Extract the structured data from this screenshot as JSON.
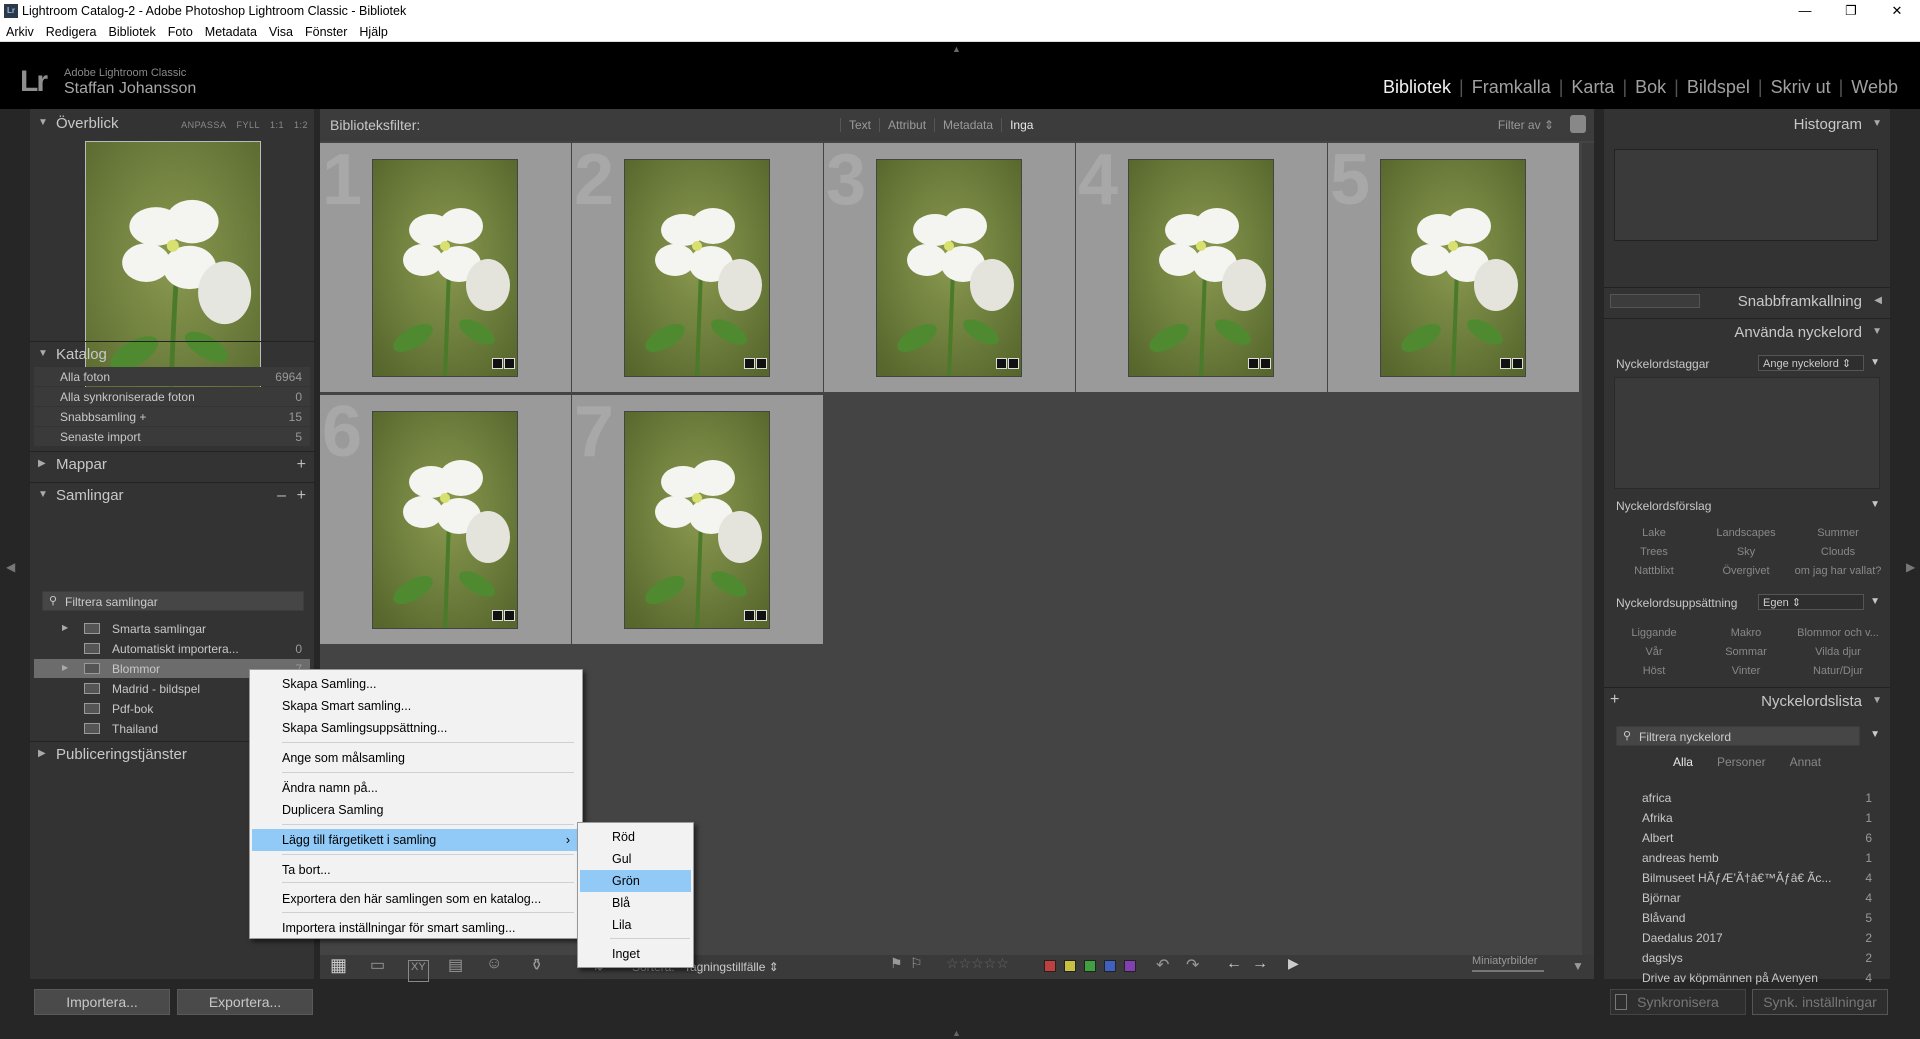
{
  "window": {
    "title": "Lightroom Catalog-2 - Adobe Photoshop Lightroom Classic - Bibliotek",
    "app_icon": "Lr"
  },
  "menubar": [
    "Arkiv",
    "Redigera",
    "Bibliotek",
    "Foto",
    "Metadata",
    "Visa",
    "Fönster",
    "Hjälp"
  ],
  "identity": {
    "logo": "Lr",
    "app_name": "Adobe Lightroom Classic",
    "user": "Staffan Johansson"
  },
  "modules": {
    "active": "Bibliotek",
    "items": [
      "Bibliotek",
      "Framkalla",
      "Karta",
      "Bok",
      "Bildspel",
      "Skriv ut",
      "Webb"
    ]
  },
  "left": {
    "navigator": {
      "title": "Överblick",
      "options": [
        "ANPASSA",
        "FYLL",
        "1:1",
        "1:2"
      ]
    },
    "catalog": {
      "title": "Katalog",
      "items": [
        {
          "label": "Alla foton",
          "count": "6964"
        },
        {
          "label": "Alla synkroniserade foton",
          "count": "0"
        },
        {
          "label": "Snabbsamling +",
          "count": "15"
        },
        {
          "label": "Senaste import",
          "count": "5"
        }
      ]
    },
    "folders": {
      "title": "Mappar",
      "action": "+"
    },
    "collections": {
      "title": "Samlingar",
      "actions": [
        "–",
        "+"
      ],
      "filter_placeholder": "Filtrera samlingar",
      "items": [
        {
          "label": "Smarta samlingar",
          "count": ""
        },
        {
          "label": "Automatiskt importera...",
          "count": "0"
        },
        {
          "label": "Blommor",
          "count": "7"
        },
        {
          "label": "Madrid - bildspel",
          "count": ""
        },
        {
          "label": "Pdf-bok",
          "count": ""
        },
        {
          "label": "Thailand",
          "count": ""
        }
      ]
    },
    "publish": {
      "title": "Publiceringstjänster"
    },
    "buttons": {
      "import": "Importera...",
      "export": "Exportera..."
    }
  },
  "filterbar": {
    "label": "Biblioteksfilter:",
    "options": [
      "Text",
      "Attribut",
      "Metadata",
      "Inga"
    ],
    "active": "Inga",
    "preset": "Filter av"
  },
  "grid": {
    "cells": [
      "1",
      "2",
      "3",
      "4",
      "5",
      "6",
      "7"
    ]
  },
  "toolbar": {
    "sort_label": "Sortera:",
    "sort_value": "Tagningstillfälle",
    "thumb_label": "Miniatyrbilder"
  },
  "right": {
    "histogram": {
      "title": "Histogram"
    },
    "quickdev": {
      "title": "Snabbframkallning"
    },
    "keywording": {
      "title": "Använda nyckelord",
      "tags_label": "Nyckelordstaggar",
      "tags_select": "Ange nyckelord",
      "suggest_label": "Nyckelordsförslag",
      "suggestions": [
        "Lake",
        "Landscapes",
        "Summer",
        "Trees",
        "Sky",
        "Clouds",
        "Nattblixt",
        "Övergivet",
        "om jag har vallat?"
      ],
      "set_label": "Nyckelordsuppsättning",
      "set_select": "Egen",
      "set_items": [
        "Liggande",
        "Makro",
        "Blommor och v...",
        "Vår",
        "Sommar",
        "Vilda djur",
        "Höst",
        "Vinter",
        "Natur/Djur"
      ]
    },
    "keywordlist": {
      "title": "Nyckelordslista",
      "add": "+",
      "filter_placeholder": "Filtrera nyckelord",
      "tabs": [
        "Alla",
        "Personer",
        "Annat"
      ],
      "active_tab": "Alla",
      "items": [
        {
          "label": "africa",
          "count": "1"
        },
        {
          "label": "Afrika",
          "count": "1"
        },
        {
          "label": "Albert",
          "count": "6"
        },
        {
          "label": "andreas hemb",
          "count": "1"
        },
        {
          "label": "Bilmuseet HÃƒÆ’Ã†â€™Ãƒâ€ Ãc...",
          "count": "4"
        },
        {
          "label": "Björnar",
          "count": "4"
        },
        {
          "label": "Blåvand",
          "count": "5"
        },
        {
          "label": "Daedalus 2017",
          "count": "2"
        },
        {
          "label": "dagslys",
          "count": "2"
        },
        {
          "label": "Drive av köpmännen på Avenyen",
          "count": "4"
        }
      ]
    },
    "buttons": {
      "sync": "Synkronisera",
      "sync_settings": "Synk. inställningar"
    }
  },
  "context_menu": {
    "items": [
      "Skapa Samling...",
      "Skapa Smart samling...",
      "Skapa Samlingsuppsättning...",
      "Ange som målsamling",
      "Ändra namn på...",
      "Duplicera Samling",
      "Lägg till färgetikett i samling",
      "Ta bort...",
      "Exportera den här samlingen som en katalog...",
      "Importera inställningar för smart samling..."
    ]
  },
  "color_submenu": {
    "items": [
      "Röd",
      "Gul",
      "Grön",
      "Blå",
      "Lila",
      "Inget"
    ],
    "highlight": "Grön"
  },
  "colors": {
    "red": "#c04040",
    "yellow": "#c8c040",
    "green": "#40a040",
    "blue": "#4060c0",
    "purple": "#8040b0",
    "highlight": "#91c9f7"
  }
}
